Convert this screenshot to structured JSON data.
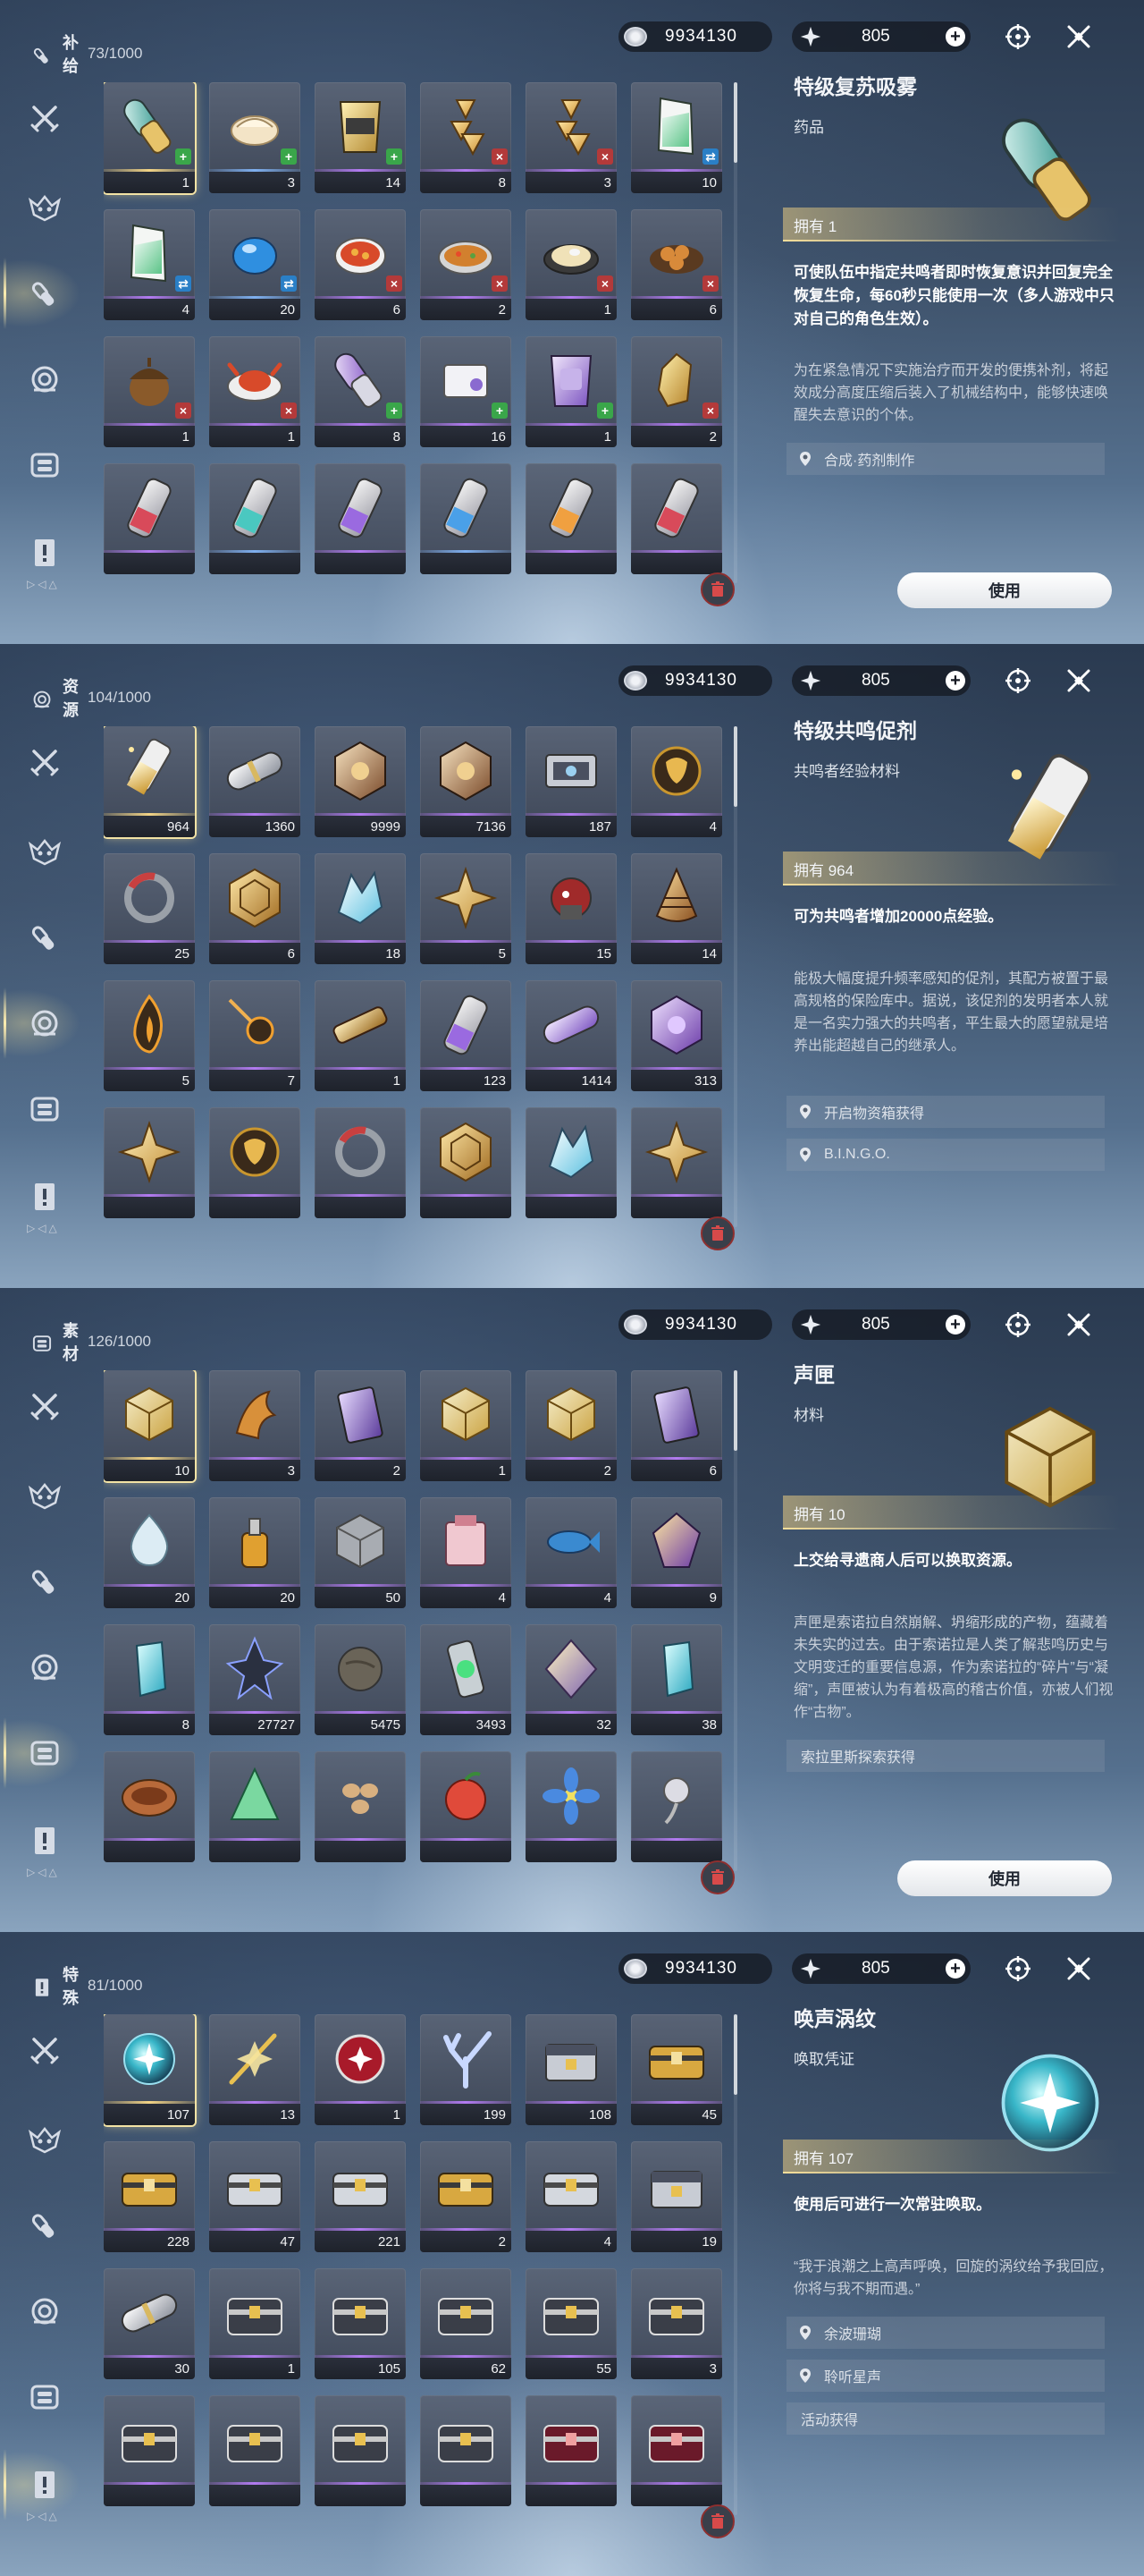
{
  "shared": {
    "currency_value": "9934130",
    "energy_value": "805",
    "energy_plus": "+"
  },
  "panels": [
    {
      "category": "补给",
      "count": "73/1000",
      "items": [
        {
          "qty": "1",
          "rarity": 4,
          "art": "inhaler-teal",
          "badge": "up",
          "selected": true
        },
        {
          "qty": "3",
          "rarity": 2,
          "art": "bun",
          "badge": "up"
        },
        {
          "qty": "14",
          "rarity": 3,
          "art": "snack-pack-gold",
          "badge": "up"
        },
        {
          "qty": "8",
          "rarity": 3,
          "art": "rice-triangles",
          "badge": "down"
        },
        {
          "qty": "3",
          "rarity": 3,
          "art": "rice-triangles",
          "badge": "down"
        },
        {
          "qty": "10",
          "rarity": 3,
          "art": "snack-pack-green",
          "badge": "swap"
        },
        {
          "qty": "4",
          "rarity": 3,
          "art": "snack-pack-green",
          "badge": "swap"
        },
        {
          "qty": "20",
          "rarity": 2,
          "art": "blue-jelly",
          "badge": "swap"
        },
        {
          "qty": "6",
          "rarity": 3,
          "art": "soup-bowl",
          "badge": "down"
        },
        {
          "qty": "2",
          "rarity": 3,
          "art": "fried-rice",
          "badge": "down"
        },
        {
          "qty": "1",
          "rarity": 3,
          "art": "noodle-plate",
          "badge": "down"
        },
        {
          "qty": "6",
          "rarity": 3,
          "art": "dumplings",
          "badge": "down"
        },
        {
          "qty": "1",
          "rarity": 3,
          "art": "acorn",
          "badge": "down"
        },
        {
          "qty": "1",
          "rarity": 3,
          "art": "crab-dish",
          "badge": "down"
        },
        {
          "qty": "8",
          "rarity": 3,
          "art": "inhaler-purple",
          "badge": "up"
        },
        {
          "qty": "16",
          "rarity": 3,
          "art": "pill-pack",
          "badge": "up"
        },
        {
          "qty": "1",
          "rarity": 3,
          "art": "snack-pack-purple",
          "badge": "up"
        },
        {
          "qty": "2",
          "rarity": 3,
          "art": "gold-crystal",
          "badge": "down"
        },
        {
          "qty": "",
          "rarity": 3,
          "art": "vial-red"
        },
        {
          "qty": "",
          "rarity": 2,
          "art": "vial-teal"
        },
        {
          "qty": "",
          "rarity": 3,
          "art": "vial-purple"
        },
        {
          "qty": "",
          "rarity": 2,
          "art": "vial-blue"
        },
        {
          "qty": "",
          "rarity": 3,
          "art": "vial-orange"
        },
        {
          "qty": "",
          "rarity": 3,
          "art": "vial-red"
        }
      ],
      "detail": {
        "name": "特级复苏吸雾",
        "type": "药品",
        "art": "inhaler-teal",
        "owned": "拥有 1",
        "effect": "可使队伍中指定共鸣者即时恢复意识并回复完全恢复生命，每60秒只能使用一次（多人游戏中只对自己的角色生效）。",
        "description": "为在紧急情况下实施治疗而开发的便携补剂，将起效成分高度压缩后装入了机械结构中，能够快速唤醒失去意识的个体。",
        "sources": [
          {
            "text": "合成·药剂制作",
            "pin": true
          }
        ],
        "use_label": "使用"
      }
    },
    {
      "category": "资源",
      "count": "104/1000",
      "items": [
        {
          "qty": "964",
          "rarity": 4,
          "art": "booster-vial",
          "selected": true
        },
        {
          "qty": "1360",
          "rarity": 3,
          "art": "capsule-silver"
        },
        {
          "qty": "9999",
          "rarity": 3,
          "art": "cube-core"
        },
        {
          "qty": "7136",
          "rarity": 3,
          "art": "cube-core"
        },
        {
          "qty": "187",
          "rarity": 3,
          "art": "device-box"
        },
        {
          "qty": "4",
          "rarity": 3,
          "art": "gold-orb"
        },
        {
          "qty": "25",
          "rarity": 3,
          "art": "ring-red"
        },
        {
          "qty": "6",
          "rarity": 3,
          "art": "hex-plate"
        },
        {
          "qty": "18",
          "rarity": 3,
          "art": "ice-shell"
        },
        {
          "qty": "5",
          "rarity": 3,
          "art": "star-shard"
        },
        {
          "qty": "15",
          "rarity": 3,
          "art": "red-mech"
        },
        {
          "qty": "14",
          "rarity": 3,
          "art": "spiral-cone"
        },
        {
          "qty": "5",
          "rarity": 3,
          "art": "dark-flame"
        },
        {
          "qty": "7",
          "rarity": 3,
          "art": "meteor"
        },
        {
          "qty": "1",
          "rarity": 3,
          "art": "cylinder-gold"
        },
        {
          "qty": "123",
          "rarity": 3,
          "art": "vial-purple"
        },
        {
          "qty": "1414",
          "rarity": 3,
          "art": "capsule-purple"
        },
        {
          "qty": "313",
          "rarity": 3,
          "art": "cube-purple"
        },
        {
          "qty": "",
          "rarity": 3,
          "art": "star-shard"
        },
        {
          "qty": "",
          "rarity": 3,
          "art": "gold-orb"
        },
        {
          "qty": "",
          "rarity": 3,
          "art": "ring-red"
        },
        {
          "qty": "",
          "rarity": 3,
          "art": "hex-plate"
        },
        {
          "qty": "",
          "rarity": 3,
          "art": "ice-shell"
        },
        {
          "qty": "",
          "rarity": 3,
          "art": "star-shard"
        }
      ],
      "detail": {
        "name": "特级共鸣促剂",
        "type": "共鸣者经验材料",
        "art": "booster-vial",
        "owned": "拥有 964",
        "effect": "可为共鸣者增加20000点经验。",
        "description": "能极大幅度提升频率感知的促剂，其配方被置于最高规格的保险库中。据说，该促剂的发明者本人就是一名实力强大的共鸣者，平生最大的愿望就是培养出能超越自己的继承人。",
        "sources": [
          {
            "text": "开启物资箱获得",
            "pin": true
          },
          {
            "text": "B.I.N.G.O.",
            "pin": true
          }
        ],
        "use_label": ""
      }
    },
    {
      "category": "素材",
      "count": "126/1000",
      "items": [
        {
          "qty": "10",
          "rarity": 4,
          "art": "gold-box",
          "selected": true
        },
        {
          "qty": "3",
          "rarity": 3,
          "art": "flame-claw"
        },
        {
          "qty": "2",
          "rarity": 3,
          "art": "purple-card"
        },
        {
          "qty": "1",
          "rarity": 3,
          "art": "gold-box"
        },
        {
          "qty": "2",
          "rarity": 3,
          "art": "gold-box"
        },
        {
          "qty": "6",
          "rarity": 3,
          "art": "purple-card"
        },
        {
          "qty": "20",
          "rarity": 3,
          "art": "water-drop"
        },
        {
          "qty": "20",
          "rarity": 3,
          "art": "gold-flask"
        },
        {
          "qty": "50",
          "rarity": 3,
          "art": "stone-cube"
        },
        {
          "qty": "4",
          "rarity": 3,
          "art": "pink-box"
        },
        {
          "qty": "4",
          "rarity": 3,
          "art": "blue-fish"
        },
        {
          "qty": "9",
          "rarity": 3,
          "art": "purple-gem"
        },
        {
          "qty": "8",
          "rarity": 3,
          "art": "cyan-crystal"
        },
        {
          "qty": "27727",
          "rarity": 3,
          "art": "dark-crystal"
        },
        {
          "qty": "5475",
          "rarity": 3,
          "art": "rock-ball"
        },
        {
          "qty": "3493",
          "rarity": 3,
          "art": "green-tube"
        },
        {
          "qty": "32",
          "rarity": 3,
          "art": "prism"
        },
        {
          "qty": "38",
          "rarity": 3,
          "art": "cyan-crystal"
        },
        {
          "qty": "",
          "rarity": 3,
          "art": "copper-bowl"
        },
        {
          "qty": "",
          "rarity": 3,
          "art": "green-shard"
        },
        {
          "qty": "",
          "rarity": 3,
          "art": "seeds"
        },
        {
          "qty": "",
          "rarity": 3,
          "art": "red-fruit"
        },
        {
          "qty": "",
          "rarity": 3,
          "art": "blue-flower"
        },
        {
          "qty": "",
          "rarity": 3,
          "art": "silver-flower"
        }
      ],
      "detail": {
        "name": "声匣",
        "type": "材料",
        "art": "gold-box",
        "owned": "拥有 10",
        "effect": "上交给寻遗商人后可以换取资源。",
        "description": "声匣是索诺拉自然崩解、坍缩形成的产物，蕴藏着未失实的过去。由于索诺拉是人类了解悲鸣历史与文明变迁的重要信息源，作为索诺拉的“碎片”与“凝缩”，声匣被认为有着极高的稽古价值，亦被人们视作“古物”。",
        "sources": [
          {
            "text": "索拉里斯探索获得",
            "pin": false
          }
        ],
        "use_label": "使用"
      }
    },
    {
      "category": "特殊",
      "count": "81/1000",
      "items": [
        {
          "qty": "107",
          "rarity": 4,
          "art": "tide-orb",
          "selected": true
        },
        {
          "qty": "13",
          "rarity": 3,
          "art": "gold-needle"
        },
        {
          "qty": "1",
          "rarity": 3,
          "art": "red-orb"
        },
        {
          "qty": "199",
          "rarity": 3,
          "art": "coral"
        },
        {
          "qty": "108",
          "rarity": 3,
          "art": "machine-chest"
        },
        {
          "qty": "45",
          "rarity": 3,
          "art": "gold-chest"
        },
        {
          "qty": "228",
          "rarity": 3,
          "art": "gold-chest"
        },
        {
          "qty": "47",
          "rarity": 3,
          "art": "silver-chest"
        },
        {
          "qty": "221",
          "rarity": 3,
          "art": "silver-chest"
        },
        {
          "qty": "2",
          "rarity": 3,
          "art": "gold-chest"
        },
        {
          "qty": "4",
          "rarity": 3,
          "art": "silver-chest"
        },
        {
          "qty": "19",
          "rarity": 3,
          "art": "machine-chest"
        },
        {
          "qty": "30",
          "rarity": 3,
          "art": "capsule-silver"
        },
        {
          "qty": "1",
          "rarity": 3,
          "art": "dark-chest"
        },
        {
          "qty": "105",
          "rarity": 3,
          "art": "dark-chest"
        },
        {
          "qty": "62",
          "rarity": 3,
          "art": "dark-chest"
        },
        {
          "qty": "55",
          "rarity": 3,
          "art": "dark-chest"
        },
        {
          "qty": "3",
          "rarity": 3,
          "art": "dark-chest"
        },
        {
          "qty": "",
          "rarity": 3,
          "art": "dark-chest"
        },
        {
          "qty": "",
          "rarity": 3,
          "art": "dark-chest"
        },
        {
          "qty": "",
          "rarity": 3,
          "art": "dark-chest"
        },
        {
          "qty": "",
          "rarity": 3,
          "art": "dark-chest"
        },
        {
          "qty": "",
          "rarity": 3,
          "art": "red-chest"
        },
        {
          "qty": "",
          "rarity": 3,
          "art": "red-chest"
        }
      ],
      "detail": {
        "name": "唤声涡纹",
        "type": "唤取凭证",
        "art": "tide-orb",
        "owned": "拥有 107",
        "effect": "使用后可进行一次常驻唤取。",
        "description": "“我于浪潮之上高声呼唤，回旋的涡纹给予我回应，你将与我不期而遇。”",
        "sources": [
          {
            "text": "余波珊瑚",
            "pin": true
          },
          {
            "text": "聆听星声",
            "pin": true
          },
          {
            "text": "活动获得",
            "pin": false
          }
        ],
        "use_label": ""
      }
    }
  ],
  "colors": {
    "rarity4": "#f3d486",
    "rarity3": "#b37bf2",
    "rarity2": "#7fb0f0",
    "rarity1": "#8fdd8f",
    "accent_gold": "#f6df9b"
  },
  "icons": {
    "sidebar": [
      "crossed-swords-icon",
      "echo-mask-icon",
      "inhaler-icon",
      "gear-core-icon",
      "material-chip-icon",
      "quest-doc-icon"
    ],
    "topbar": [
      "coin-icon",
      "star-energy-icon",
      "focus-target-icon",
      "close-x-icon",
      "trash-icon"
    ]
  }
}
